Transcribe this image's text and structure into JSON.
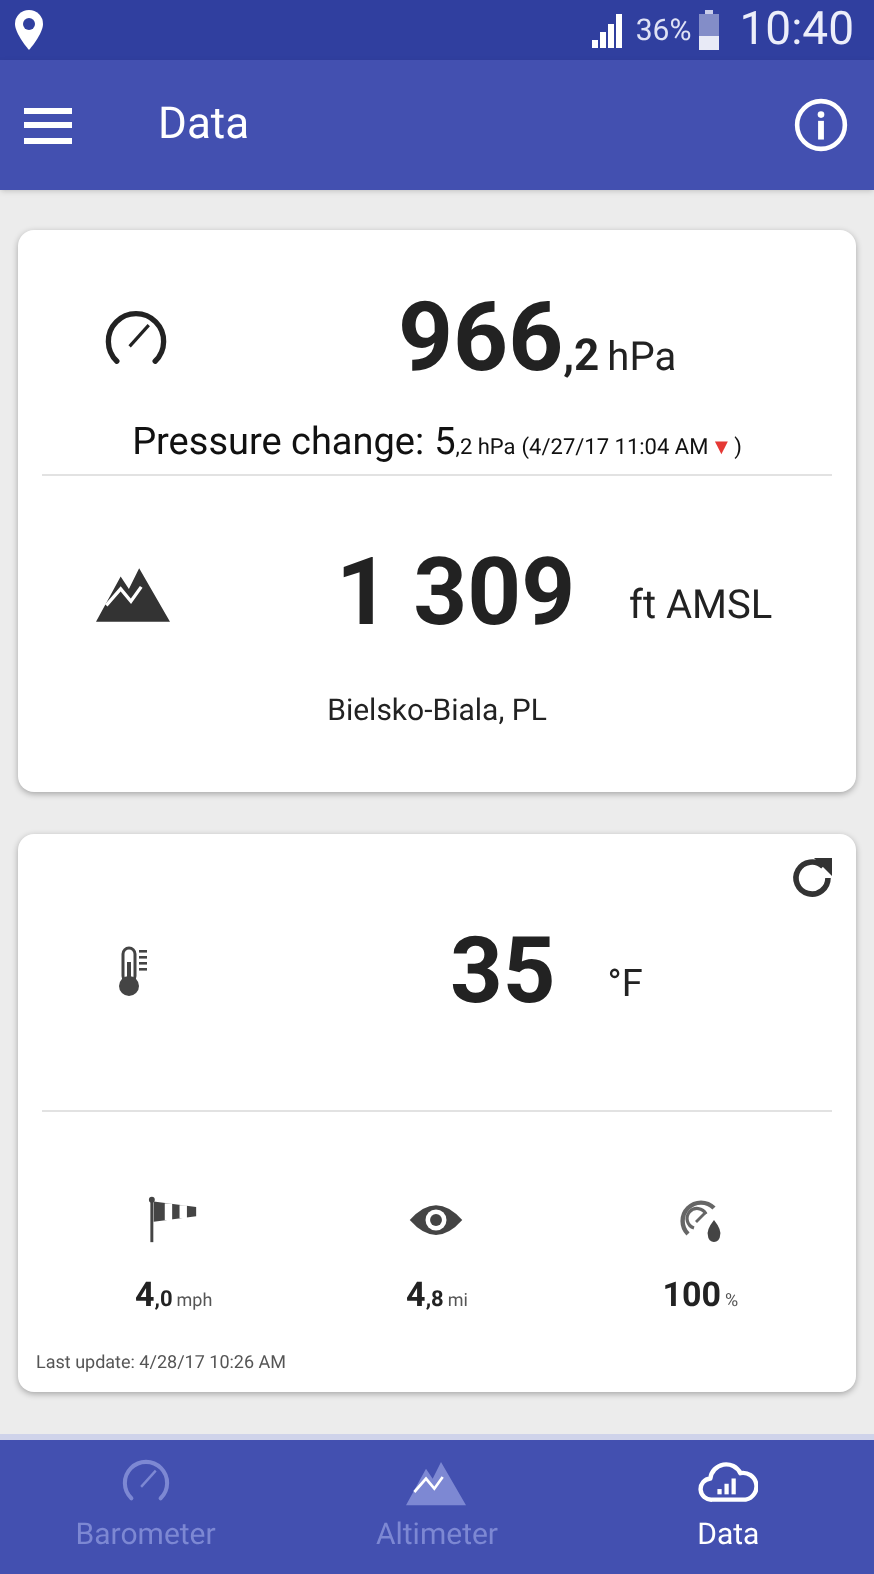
{
  "status_bar": {
    "battery": "36%",
    "time": "10:40"
  },
  "app_bar": {
    "title": "Data"
  },
  "pressure": {
    "value": "966",
    "decimal": ",2",
    "unit": "hPa"
  },
  "pressure_change": {
    "label": "Pressure change:",
    "value": "5",
    "decimal": ",2 hPa",
    "time": "(4/27/17 11:04 AM",
    "trend_icon": "▼",
    "close": ")"
  },
  "altitude": {
    "value": "1 309",
    "unit": "ft AMSL",
    "location": "Bielsko-Biala, PL"
  },
  "temperature": {
    "value": "35",
    "unit": "°F"
  },
  "conditions": [
    {
      "kind": "wind",
      "value": "4",
      "decimal": ",0",
      "unit": "mph"
    },
    {
      "kind": "visibility",
      "value": "4",
      "decimal": ",8",
      "unit": "mi"
    },
    {
      "kind": "humidity",
      "value": "100",
      "unit": "%"
    }
  ],
  "last_update": "Last update: 4/28/17 10:26 AM",
  "bottom_nav": [
    {
      "kind": "barometer",
      "label": "Barometer",
      "selected": false
    },
    {
      "kind": "altimeter",
      "label": "Altimeter",
      "selected": false
    },
    {
      "kind": "data",
      "label": "Data",
      "selected": true
    }
  ]
}
